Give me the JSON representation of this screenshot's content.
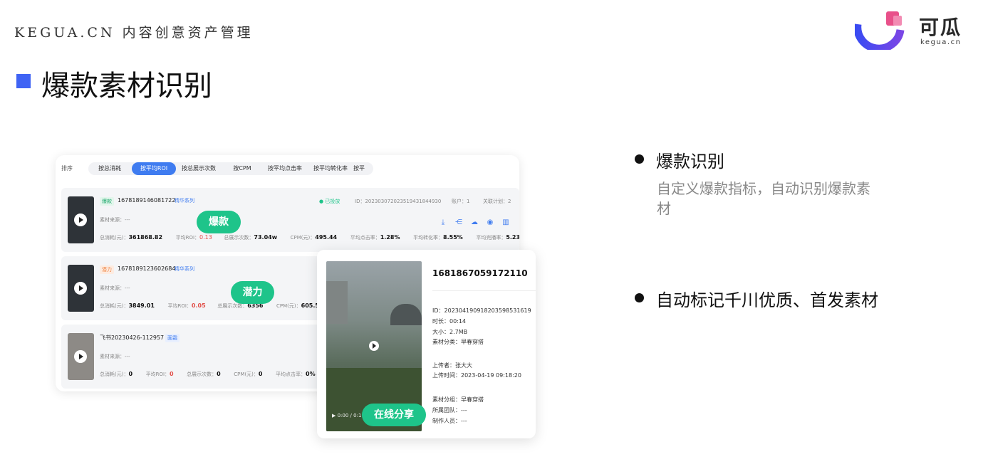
{
  "header": {
    "brand": "KEGUA.CN 内容创意资产管理",
    "title": "爆款素材识别",
    "logo_text": "可瓜",
    "logo_sub": "kegua.cn"
  },
  "panel": {
    "sort_label": "排序",
    "tabs": [
      "按总消耗",
      "按平均ROI",
      "按总展示次数",
      "按CPM",
      "按平均点击率",
      "按平均转化率",
      "按平"
    ],
    "rows": [
      {
        "badge": "爆款",
        "id": "1678189146081722",
        "series": "精华系列",
        "status": "● 已投放",
        "row_id": "ID：20230307202351943184493​0",
        "account": "账户：1",
        "linked": "关联计划：2",
        "source_label": "素材来源：",
        "source_val": "---",
        "spend_label": "总消耗(元)：",
        "spend": "361868.82",
        "roi_label": "平均ROI：",
        "roi": "0.13",
        "impr_label": "总展示次数：",
        "impr": "73.04w",
        "cpm_label": "CPM(元)：",
        "cpm": "495.44",
        "ctr_label": "平均点击率：",
        "ctr": "1.28%",
        "cvr_label": "平均转化率：",
        "cvr": "8.55%",
        "comp_label": "平均完播率：",
        "comp": "5.23%"
      },
      {
        "badge": "潜力",
        "id": "1678189123602684",
        "series": "精华系列",
        "source_label": "素材来源：",
        "source_val": "---",
        "spend_label": "总消耗(元)：",
        "spend": "3849.01",
        "roi_label": "平均ROI：",
        "roi": "0.05",
        "impr_label": "总展示次数：",
        "impr": "6356",
        "cpm_label": "CPM(元)：",
        "cpm": "605.57"
      },
      {
        "title": "飞书20230426-112957",
        "series": "面霜",
        "source_label": "素材来源：",
        "source_val": "---",
        "spend_label": "总消耗(元)：",
        "spend": "0",
        "roi_label": "平均ROI：",
        "roi": "0",
        "impr_label": "总展示次数：",
        "impr": "0",
        "cpm_label": "CPM(元)：",
        "cpm": "0",
        "ctr_label": "平均点击率：",
        "ctr": "0%"
      }
    ]
  },
  "pills": {
    "hot": "爆款",
    "potential": "潜力",
    "share": "在线分享"
  },
  "card": {
    "id": "1681867059172110",
    "video_time": "▶  0:00 / 0:1",
    "meta": [
      "ID：20230419091820359853161​9",
      "时长：00:14",
      "大小：2.7MB",
      "素材分类：早春穿搭",
      "上传者：张大大",
      "上传时间：2023-04-19 09:18:20",
      "素材分组：早春穿搭",
      "所属团队：---",
      "制作人员：---"
    ]
  },
  "bullets": [
    {
      "title": "爆款识别",
      "desc": "自定义爆款指标，自动识别爆款素材"
    },
    {
      "title": "自动标记千川优质、首发素材"
    }
  ],
  "colors": {
    "accent": "#3f63f4",
    "green": "#1ec48a",
    "tab_active": "#3f7cf0",
    "red": "#e2504a"
  }
}
